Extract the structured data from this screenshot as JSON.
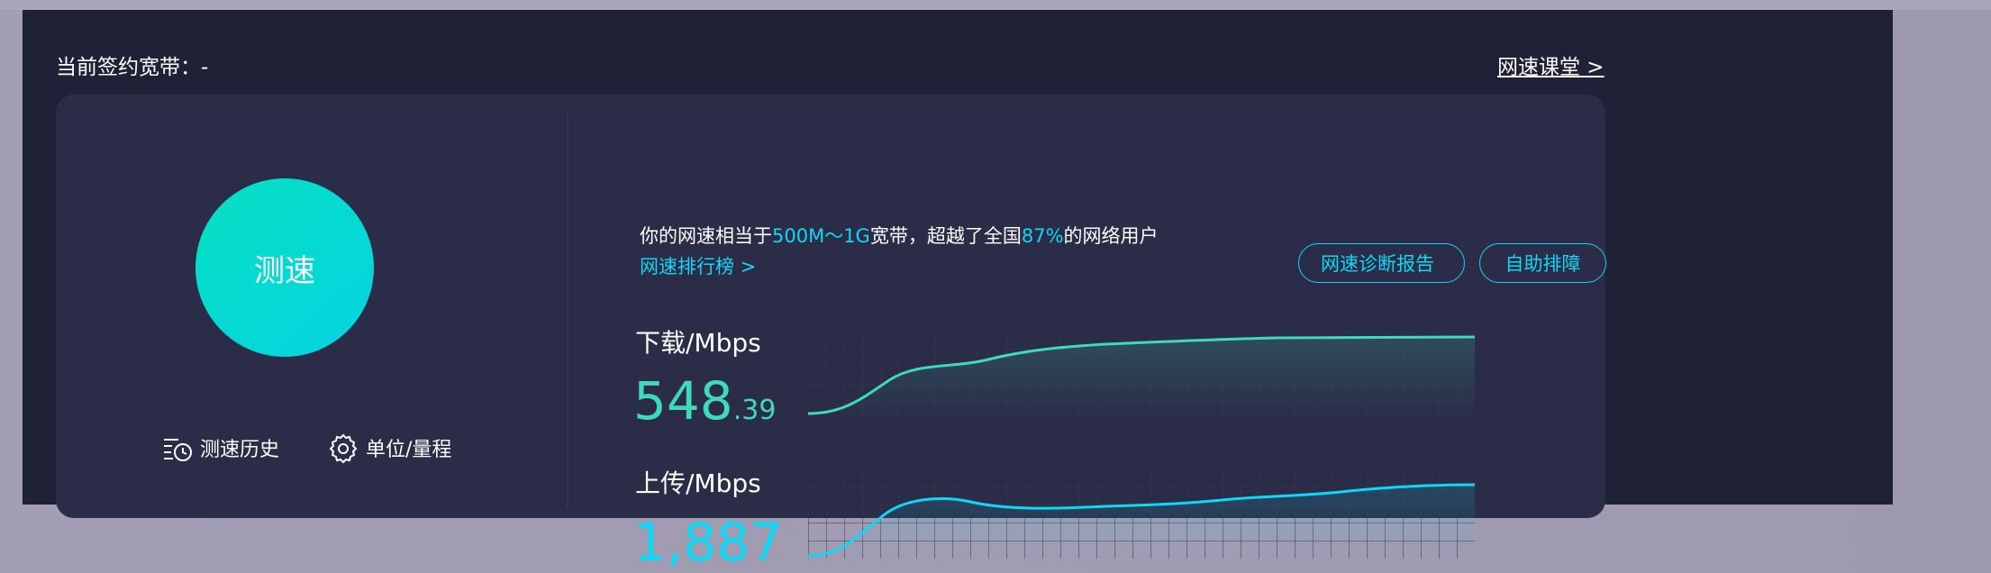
{
  "header": {
    "contract_label": "当前签约宽带：-",
    "speed_school_link": "网速课堂 >"
  },
  "left": {
    "speed_test_button": "测速",
    "history_label": "测速历史",
    "unit_label": "单位/量程",
    "icons": {
      "history": "history-clock-icon",
      "settings": "gear-icon"
    }
  },
  "summary": {
    "prefix": "你的网速相当于",
    "equivalent": "500M～1G",
    "middle": "宽带，超越了全国",
    "percent": "87%",
    "suffix": "的网络用户",
    "ranking_link": "网速排行榜 >"
  },
  "actions": {
    "diagnosis": "网速诊断报告",
    "self_help": "自助排障"
  },
  "download": {
    "label": "下载/Mbps",
    "value_int": "548",
    "value_dec": ".39",
    "color": "#3ddbb8"
  },
  "upload": {
    "label": "上传/Mbps",
    "value": "1,887",
    "color": "#0ed8f5"
  }
}
